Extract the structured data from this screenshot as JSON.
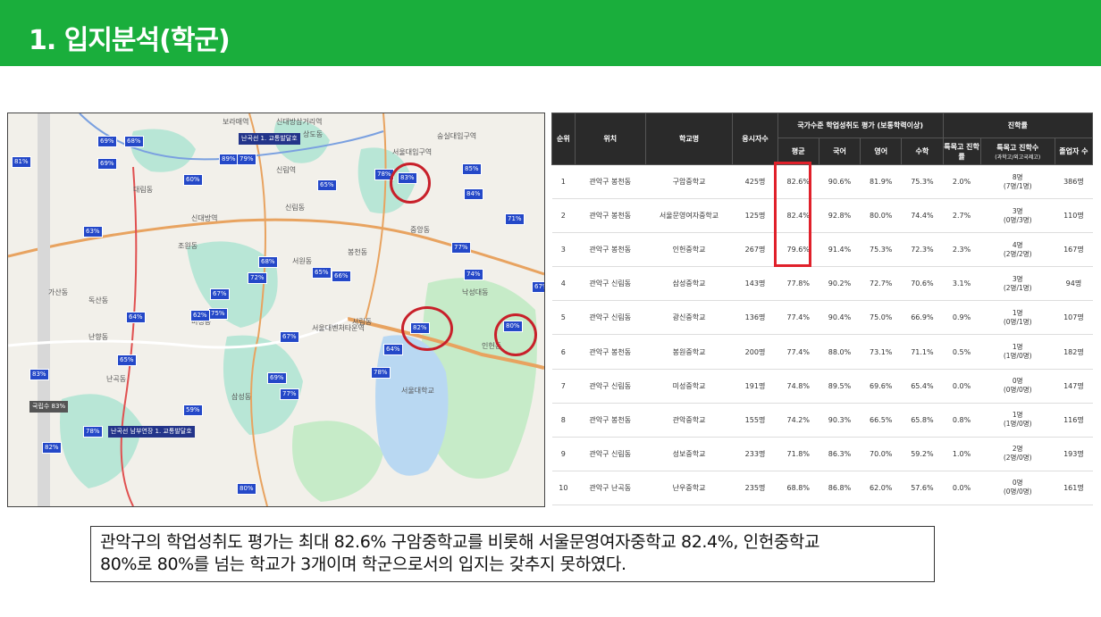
{
  "header": {
    "title": "1. 입지분석(학군)"
  },
  "map": {
    "pins": [
      "69%",
      "68%",
      "81%",
      "69%",
      "60%",
      "89%",
      "79%",
      "78%",
      "83%",
      "85%",
      "84%",
      "71%",
      "65%",
      "63%",
      "77%",
      "74%",
      "67%",
      "68%",
      "72%",
      "65%",
      "66%",
      "67%",
      "75%",
      "62%",
      "64%",
      "82%",
      "80%",
      "67%",
      "64%",
      "78%",
      "69%",
      "77%",
      "59%",
      "65%",
      "83%",
      "78%",
      "82%",
      "80%"
    ],
    "circled": [
      "83%",
      "82%",
      "80%"
    ],
    "labels": [
      "서울대입구역",
      "상도동",
      "숭실대입구역",
      "보라매역",
      "신대방삼거리역",
      "봉천동",
      "대림동",
      "신림동",
      "서원동",
      "서림동",
      "난곡동",
      "난향동",
      "미성동",
      "삼성동",
      "중앙동",
      "낙성대동",
      "인헌동",
      "조원동",
      "독산동",
      "가산동",
      "신대방역",
      "신림역",
      "서울대벤처타운역",
      "서울대학교"
    ],
    "boxes": [
      "난곡선 1. 교통발달호",
      "난곡선 남부연장 1. 교통발달호",
      "국립수 83%"
    ]
  },
  "table": {
    "headers": {
      "rank": "순위",
      "location": "위치",
      "school": "학교명",
      "examinees": "응시자수",
      "group_eval": "국가수준 학업성취도 평가 (보통학력이상)",
      "avg": "평균",
      "kor": "국어",
      "eng": "영어",
      "math": "수학",
      "group_adv": "진학률",
      "special_rate": "특목고 진학률",
      "special_count": "특목고 진학수",
      "special_count_sub": "(과학고/외고국제고)",
      "admitted": "졸업자 수"
    },
    "rows": [
      [
        "1",
        "관악구 봉천동",
        "구암중학교",
        "425명",
        "82.6%",
        "90.6%",
        "81.9%",
        "75.3%",
        "2.0%",
        "8명",
        "(7명/1명)",
        "386명"
      ],
      [
        "2",
        "관악구 봉천동",
        "서울문영여자중학교",
        "125명",
        "82.4%",
        "92.8%",
        "80.0%",
        "74.4%",
        "2.7%",
        "3명",
        "(0명/3명)",
        "110명"
      ],
      [
        "3",
        "관악구 봉천동",
        "인헌중학교",
        "267명",
        "79.6%",
        "91.4%",
        "75.3%",
        "72.3%",
        "2.3%",
        "4명",
        "(2명/2명)",
        "167명"
      ],
      [
        "4",
        "관악구 신림동",
        "삼성중학교",
        "143명",
        "77.8%",
        "90.2%",
        "72.7%",
        "70.6%",
        "3.1%",
        "3명",
        "(2명/1명)",
        "94명"
      ],
      [
        "5",
        "관악구 신림동",
        "광신중학교",
        "136명",
        "77.4%",
        "90.4%",
        "75.0%",
        "66.9%",
        "0.9%",
        "1명",
        "(0명/1명)",
        "107명"
      ],
      [
        "6",
        "관악구 봉천동",
        "봉원중학교",
        "200명",
        "77.4%",
        "88.0%",
        "73.1%",
        "71.1%",
        "0.5%",
        "1명",
        "(1명/0명)",
        "182명"
      ],
      [
        "7",
        "관악구 신림동",
        "미성중학교",
        "191명",
        "74.8%",
        "89.5%",
        "69.6%",
        "65.4%",
        "0.0%",
        "0명",
        "(0명/0명)",
        "147명"
      ],
      [
        "8",
        "관악구 봉천동",
        "관악중학교",
        "155명",
        "74.2%",
        "90.3%",
        "66.5%",
        "65.8%",
        "0.8%",
        "1명",
        "(1명/0명)",
        "116명"
      ],
      [
        "9",
        "관악구 신림동",
        "성보중학교",
        "233명",
        "71.8%",
        "86.3%",
        "70.0%",
        "59.2%",
        "1.0%",
        "2명",
        "(2명/0명)",
        "193명"
      ],
      [
        "10",
        "관악구 난곡동",
        "난우중학교",
        "235명",
        "68.8%",
        "86.8%",
        "62.0%",
        "57.6%",
        "0.0%",
        "0명",
        "(0명/0명)",
        "161명"
      ]
    ]
  },
  "summary": {
    "line1": "관악구의 학업성취도 평가는 최대 82.6% 구암중학교를 비롯해 서울문영여자중학교 82.4%, 인헌중학교",
    "line2": "80%로 80%를 넘는 학교가 3개이며 학군으로서의 입지는 갖추지 못하였다."
  }
}
